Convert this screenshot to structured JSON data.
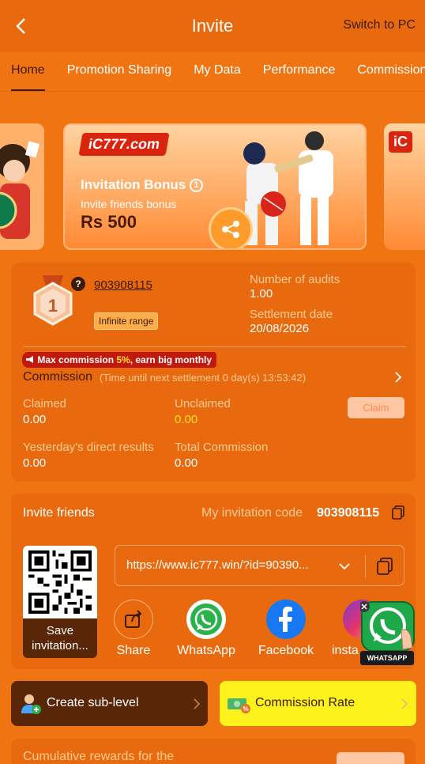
{
  "header": {
    "title": "Invite",
    "switch_label": "Switch to PC"
  },
  "tabs": [
    {
      "label": "Home",
      "active": true
    },
    {
      "label": "Promotion Sharing"
    },
    {
      "label": "My Data"
    },
    {
      "label": "Performance"
    },
    {
      "label": "Commission"
    }
  ],
  "banner": {
    "logo": "iC777.com",
    "title": "Invitation Bonus",
    "title_badge": "1",
    "subtitle": "Invite friends bonus",
    "amount": "Rs 500"
  },
  "profile": {
    "level": "1",
    "help_icon": "?",
    "user_id": "903908115",
    "range_badge": "Infinite range",
    "audits_label": "Number of audits",
    "audits_value": "1.00",
    "settlement_label": "Settlement date",
    "settlement_value": "20/08/2026"
  },
  "commission": {
    "promo_prefix": "Max commission ",
    "promo_pct": "5%",
    "promo_suffix": ", earn big monthly",
    "title": "Commission",
    "subtitle": "(Time until next settlement  0 day(s) 13:53:42)",
    "claimed_label": "Claimed",
    "claimed_value": "0.00",
    "unclaimed_label": "Unclaimed",
    "unclaimed_value": "0.00",
    "claim_button": "Claim",
    "yesterday_label": "Yesterday's direct results",
    "yesterday_value": "0.00",
    "total_label": "Total Commission",
    "total_value": "0.00"
  },
  "invite": {
    "title": "Invite friends",
    "code_label": "My invitation code",
    "code_value": "903908115",
    "qr_caption_1": "Save",
    "qr_caption_2": "invitation...",
    "link": "https://www.ic777.win/?id=90390...",
    "share": [
      {
        "label": "Share",
        "icon": "share-icon"
      },
      {
        "label": "WhatsApp",
        "icon": "whatsapp-icon"
      },
      {
        "label": "Facebook",
        "icon": "facebook-icon"
      },
      {
        "label": "insta",
        "icon": "instagram-icon"
      }
    ],
    "float_label": "WHATSAPP"
  },
  "actions": {
    "sub_level": "Create sub-level",
    "commission_rate": "Commission Rate"
  },
  "footer": {
    "cumulative": "Cumulative rewards for the"
  },
  "colors": {
    "bg": "#f07412",
    "card": "#e96a0e",
    "dark": "#3b1a06",
    "muted": "#ffcc95",
    "yellow": "#fdf21c",
    "highlight": "#ffe02a"
  }
}
